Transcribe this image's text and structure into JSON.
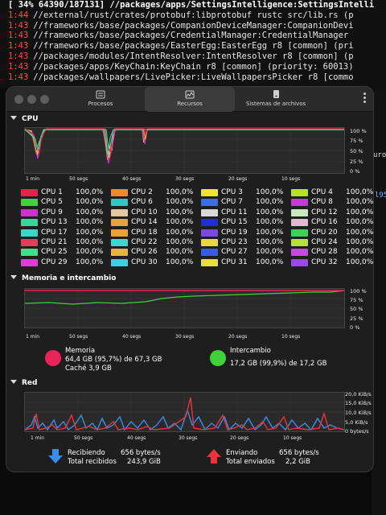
{
  "terminal": {
    "header": "[ 34% 64390/187131] //packages/apps/SettingsIntelligence:SettingsIntelli",
    "lines": [
      {
        "time": "1:44",
        "text": "//external/rust/crates/protobuf:libprotobuf rustc src/lib.rs (p"
      },
      {
        "time": "1:43",
        "text": "//frameworks/base/packages/CompanionDeviceManager:CompanionDevi"
      },
      {
        "time": "1:43",
        "text": "//frameworks/base/packages/CredentialManager:CredentialManager"
      },
      {
        "time": "1:43",
        "text": "//frameworks/base/packages/EasterEgg:EasterEgg r8 [common] (pri"
      },
      {
        "time": "1:43",
        "text": "//packages/modules/IntentResolver:IntentResolver r8 [common] (p"
      },
      {
        "time": "1:43",
        "text": "//packages/apps/KeyChain:KeyChain r8 [common] (priority: 60013)"
      },
      {
        "time": "1:43",
        "text": "//packages/wallpapers/LivePicker:LiveWallpapersPicker r8 [commo"
      }
    ],
    "right_fragments": [
      "uro",
      "l95"
    ]
  },
  "toolbar": {
    "tabs": [
      {
        "label": "Procesos",
        "icon": "list-icon"
      },
      {
        "label": "Recursos",
        "icon": "gauge-icon"
      },
      {
        "label": "Sistemas de archivos",
        "icon": "drive-icon"
      }
    ],
    "active_tab": "Recursos",
    "menu_icon": "kebab-menu-icon"
  },
  "cpu": {
    "title": "CPU",
    "y_ticks": [
      "100 %",
      "75 %",
      "50 %",
      "25 %",
      "0 %"
    ],
    "x_ticks": [
      "1 min",
      "50 segs",
      "40 segs",
      "30 segs",
      "20 segs",
      "10 segs"
    ],
    "cores": [
      {
        "name": "CPU 1",
        "value": "100,0%",
        "color": "#e8234a"
      },
      {
        "name": "CPU 2",
        "value": "100,0%",
        "color": "#f08a24"
      },
      {
        "name": "CPU 3",
        "value": "100,0%",
        "color": "#f1e23a"
      },
      {
        "name": "CPU 4",
        "value": "100,0%",
        "color": "#b7e02a"
      },
      {
        "name": "CPU 5",
        "value": "100,0%",
        "color": "#3fd23a"
      },
      {
        "name": "CPU 6",
        "value": "100,0%",
        "color": "#2fc7c4"
      },
      {
        "name": "CPU 7",
        "value": "100,0%",
        "color": "#3a6ee8"
      },
      {
        "name": "CPU 8",
        "value": "100,0%",
        "color": "#c23ad8"
      },
      {
        "name": "CPU 9",
        "value": "100,0%",
        "color": "#d12fd0"
      },
      {
        "name": "CPU 10",
        "value": "100,0%",
        "color": "#e6c8a0"
      },
      {
        "name": "CPU 11",
        "value": "100,0%",
        "color": "#d9d9d9"
      },
      {
        "name": "CPU 12",
        "value": "100,0%",
        "color": "#c8e8c0"
      },
      {
        "name": "CPU 13",
        "value": "100,0%",
        "color": "#37d79a"
      },
      {
        "name": "CPU 14",
        "value": "100,0%",
        "color": "#e8a23a"
      },
      {
        "name": "CPU 15",
        "value": "100,0%",
        "color": "#1f2fd6"
      },
      {
        "name": "CPU 16",
        "value": "100,0%",
        "color": "#e2b8d0"
      },
      {
        "name": "CPU 17",
        "value": "100,0%",
        "color": "#3ad8c8"
      },
      {
        "name": "CPU 18",
        "value": "100,0%",
        "color": "#f0a030"
      },
      {
        "name": "CPU 19",
        "value": "100,0%",
        "color": "#7a4ae0"
      },
      {
        "name": "CPU 20",
        "value": "100,0%",
        "color": "#3fd05a"
      },
      {
        "name": "CPU 21",
        "value": "100,0%",
        "color": "#e83a5a"
      },
      {
        "name": "CPU 22",
        "value": "100,0%",
        "color": "#3ad8d0"
      },
      {
        "name": "CPU 23",
        "value": "100,0%",
        "color": "#e8d83a"
      },
      {
        "name": "CPU 24",
        "value": "100,0%",
        "color": "#b8e03a"
      },
      {
        "name": "CPU 25",
        "value": "100,0%",
        "color": "#3ee08a"
      },
      {
        "name": "CPU 26",
        "value": "100,0%",
        "color": "#f0b040"
      },
      {
        "name": "CPU 27",
        "value": "100,0%",
        "color": "#3a5ae8"
      },
      {
        "name": "CPU 28",
        "value": "100,0%",
        "color": "#c84ae0"
      },
      {
        "name": "CPU 29",
        "value": "100,0%",
        "color": "#e03ad8"
      },
      {
        "name": "CPU 30",
        "value": "100,0%",
        "color": "#3ad0e8"
      },
      {
        "name": "CPU 31",
        "value": "100,0%",
        "color": "#e8e03a"
      },
      {
        "name": "CPU 32",
        "value": "100,0%",
        "color": "#9a4ae8"
      }
    ]
  },
  "memory": {
    "title": "Memoria e intercambio",
    "y_ticks": [
      "100 %",
      "75 %",
      "50 %",
      "25 %",
      "0 %"
    ],
    "x_ticks": [
      "1 min",
      "50 segs",
      "40 segs",
      "30 segs",
      "20 segs",
      "10 segs"
    ],
    "mem_label": "Memoria",
    "mem_value": "64,4 GB (95,7%) de 67,3 GB",
    "cache": "Caché 3,9 GB",
    "mem_color": "#e8245a",
    "swap_label": "Intercambio",
    "swap_value": "17,2 GB (99,9%) de 17,2 GB",
    "swap_color": "#3fd23a"
  },
  "network": {
    "title": "Red",
    "y_ticks": [
      "20,0 KiB/s",
      "15,0 KiB/s",
      "10,0 KiB/s",
      "5,0 KiB/s",
      "0 bytes/s"
    ],
    "x_ticks": [
      "1 min",
      "50 segs",
      "40 segs",
      "30 segs",
      "20 segs",
      "10 segs"
    ],
    "recv_label": "Recibiendo",
    "recv_rate": "656 bytes/s",
    "recv_total_label": "Total recibidos",
    "recv_total": "243,9 GiB",
    "recv_color": "#3a8ee8",
    "send_label": "Enviando",
    "send_rate": "656 bytes/s",
    "send_total_label": "Total enviados",
    "send_total": "2,2 GiB",
    "send_color": "#e8343a"
  }
}
